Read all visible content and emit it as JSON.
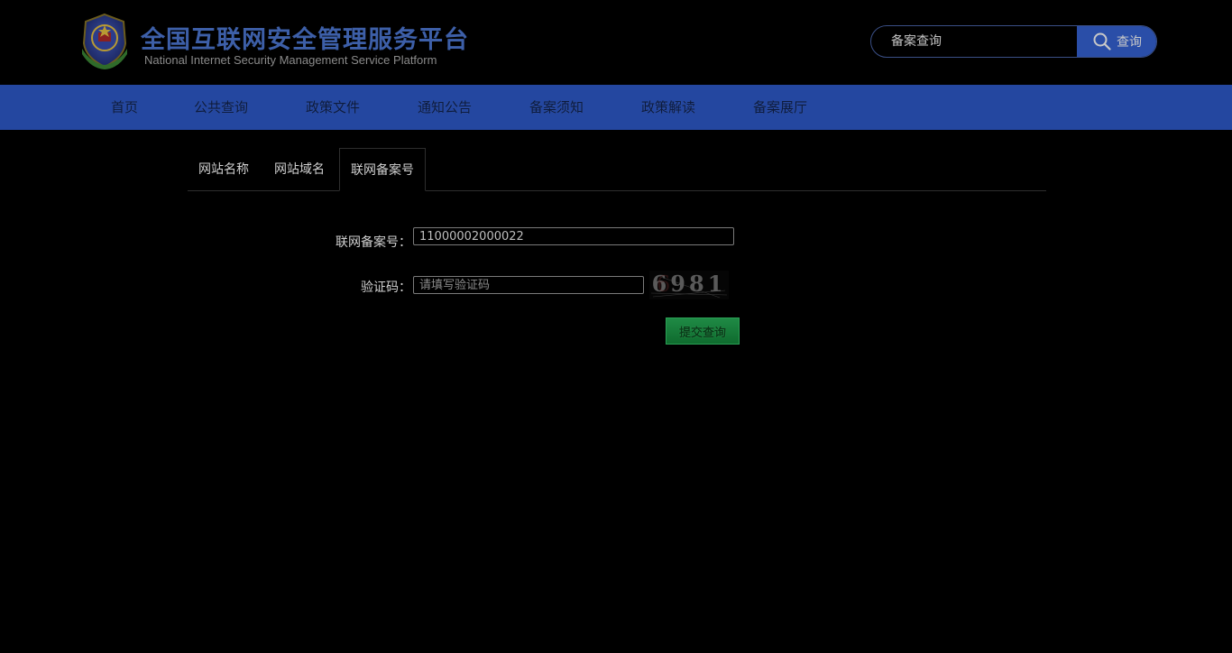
{
  "header": {
    "title": "全国互联网安全管理服务平台",
    "subtitle": "National Internet Security Management Service Platform",
    "search": {
      "placeholder": "备案查询",
      "button_label": "查询"
    }
  },
  "nav": {
    "items": [
      {
        "label": "首页"
      },
      {
        "label": "公共查询"
      },
      {
        "label": "政策文件"
      },
      {
        "label": "通知公告"
      },
      {
        "label": "备案须知"
      },
      {
        "label": "政策解读"
      },
      {
        "label": "备案展厅"
      }
    ]
  },
  "tabs": {
    "items": [
      {
        "label": "网站名称"
      },
      {
        "label": "网站域名"
      },
      {
        "label": "联网备案号"
      }
    ],
    "active": "联网备案号"
  },
  "form": {
    "record_label": "联网备案号：",
    "record_value": "11000002000022",
    "captcha_label": "验证码：",
    "captcha_placeholder": "请填写验证码",
    "captcha_text": "6981",
    "submit_label": "提交查询"
  },
  "colors": {
    "nav_bg": "#2447a0",
    "title": "#3d5fa8",
    "button_green": "#1f8a45"
  }
}
